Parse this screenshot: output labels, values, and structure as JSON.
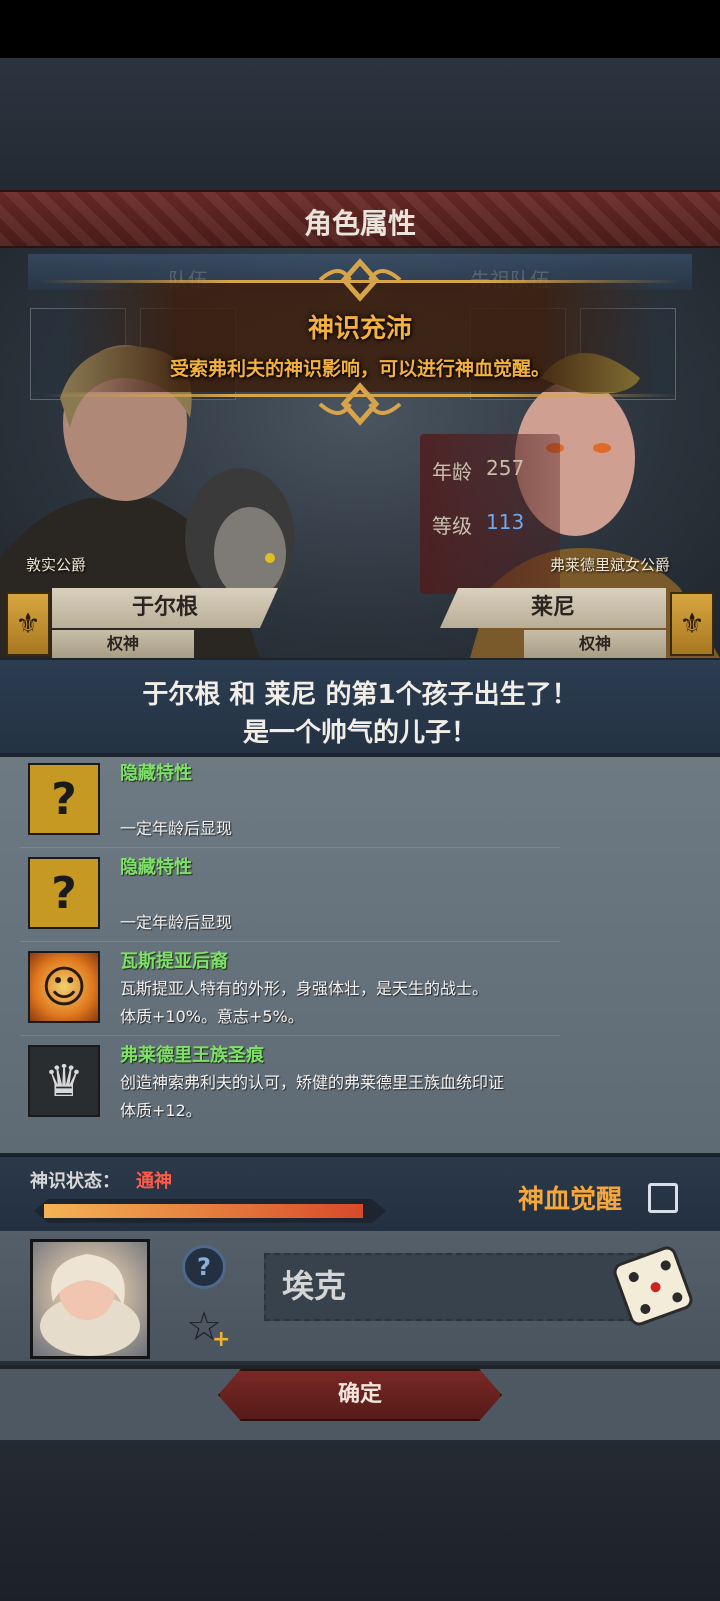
{
  "header": {
    "title": "角色属性"
  },
  "tabs": [
    {
      "label": "队伍"
    },
    {
      "label": "先祖队伍"
    }
  ],
  "notice": {
    "title": "神识充沛",
    "desc": "受索弗利夫的神识影响，可以进行神血觉醒。"
  },
  "stats": {
    "age_label": "年龄",
    "age": "257",
    "level_label": "等级",
    "level": "113"
  },
  "father": {
    "title": "敦实公爵",
    "name": "于尔根",
    "rank": "权神"
  },
  "mother": {
    "title": "弗莱德里斌女公爵",
    "name": "莱尼",
    "rank": "权神"
  },
  "birth": {
    "line1": "于尔根 和 莱尼 的第1个孩子出生了！",
    "line2": "是一个帅气的儿子！"
  },
  "traits": [
    {
      "icon": "question-icon",
      "name": "隐藏特性",
      "desc1": "",
      "desc2": "一定年龄后显现"
    },
    {
      "icon": "question-icon",
      "name": "隐藏特性",
      "desc1": "",
      "desc2": "一定年龄后显现"
    },
    {
      "icon": "smiley-face-icon",
      "name": "瓦斯提亚后裔",
      "desc1": "瓦斯提亚人特有的外形，身强体壮，是天生的战士。",
      "desc2": "体质+10%。意志+5%。"
    },
    {
      "icon": "royal-crest-icon",
      "name": "弗莱德里王族圣痕",
      "desc1": "创造神索弗利夫的认可，矫健的弗莱德里王族血统印证",
      "desc2": "体质+12。"
    }
  ],
  "status": {
    "label": "神识状态：",
    "value": "通神",
    "progress": 0.96,
    "awaken_label": "神血觉醒"
  },
  "naming": {
    "name": "埃克"
  },
  "confirm": {
    "label": "确定"
  },
  "colors": {
    "accent": "#f5a73c",
    "trait_name": "#7fe06a",
    "status_red": "#ff5b4a"
  }
}
